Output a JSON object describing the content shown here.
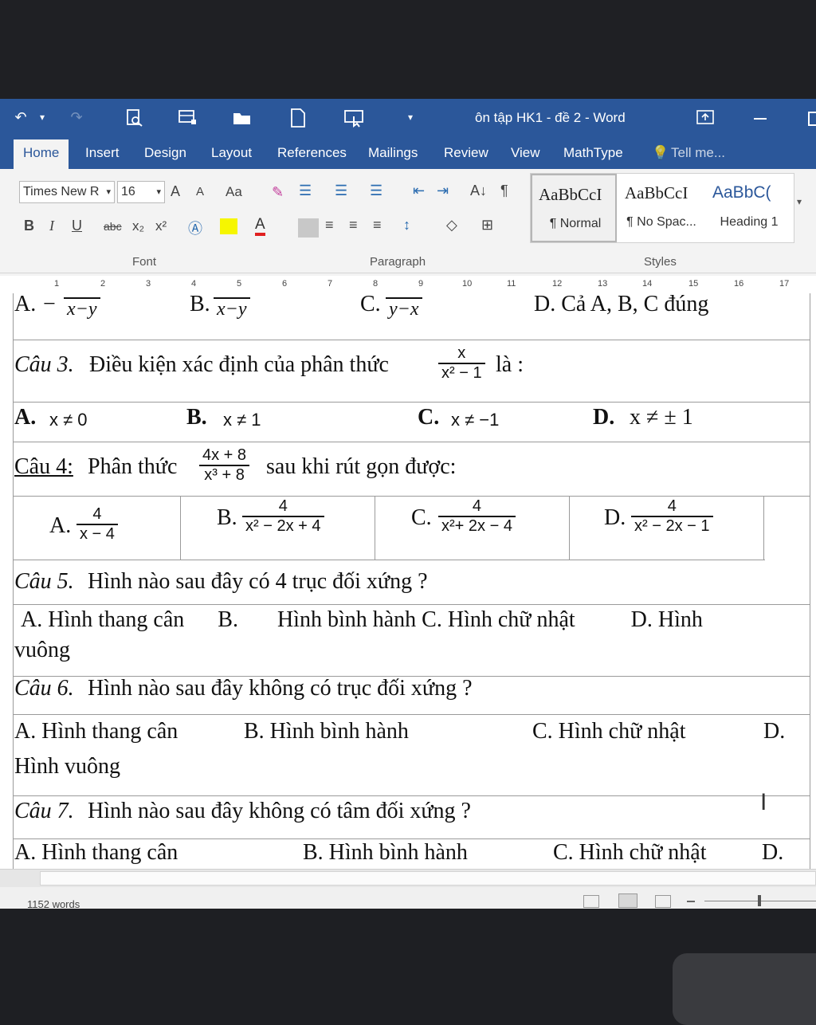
{
  "window": {
    "title": "ôn tập HK1 - đề 2 - Word"
  },
  "tabs": [
    "Home",
    "Insert",
    "Design",
    "Layout",
    "References",
    "Mailings",
    "Review",
    "View",
    "MathType"
  ],
  "tell_me": "Tell me...",
  "font": {
    "name": "Times New R",
    "size": "16"
  },
  "ribbon_glyphs": {
    "bold": "B",
    "italic": "I",
    "underline": "U",
    "strike": "abc",
    "sub": "x₂",
    "sup": "x²",
    "grow": "A",
    "shrink": "A",
    "case": "Aa",
    "pilcrow": "¶",
    "sort": "A↓"
  },
  "styles": [
    {
      "preview": "AaBbCcI",
      "name": "¶ Normal"
    },
    {
      "preview": "AaBbCcI",
      "name": "¶ No Spac..."
    },
    {
      "preview": "AaBbC(",
      "name": "Heading 1"
    }
  ],
  "group_labels": {
    "font": "Font",
    "paragraph": "Paragraph",
    "styles": "Styles"
  },
  "ruler": [
    "1",
    "2",
    "3",
    "4",
    "5",
    "6",
    "7",
    "8",
    "9",
    "10",
    "11",
    "12",
    "13",
    "14",
    "15",
    "16",
    "17"
  ],
  "document": {
    "q2_opts": {
      "a": {
        "label": "A.",
        "num": "",
        "den": "x−y",
        "sign": "−"
      },
      "b": {
        "label": "B.",
        "num": "",
        "den": "x−y"
      },
      "c": {
        "label": "C.",
        "num": "",
        "den": "y−x"
      },
      "d": {
        "label": "D. Cả A, B, C đúng"
      }
    },
    "q3": {
      "label": "Câu 3.",
      "text": "Điều kiện xác định của phân thức",
      "num": "x",
      "den": "x² − 1",
      "tail": "là :",
      "a_label": "A.",
      "a": "x ≠ 0",
      "b_label": "B.",
      "b": "x ≠ 1",
      "c_label": "C.",
      "c": "x ≠ −1",
      "d_label": "D.",
      "d": "x ≠ ± 1"
    },
    "q4": {
      "label": "Câu 4:",
      "text": "Phân thức",
      "num": "4x + 8",
      "den": "x³ + 8",
      "tail": "sau khi rút gọn được:",
      "a_label": "A.",
      "a_num": "4",
      "a_den": "x − 4",
      "b_label": "B.",
      "b_num": "4",
      "b_den": "x² − 2x + 4",
      "c_label": "C.",
      "c_num": "4",
      "c_den": "x²+ 2x − 4",
      "d_label": "D.",
      "d_num": "4",
      "d_den": "x² − 2x − 1"
    },
    "q5": {
      "label": "Câu 5.",
      "text": "Hình nào sau đây có 4 trục đối xứng ?",
      "line1": "A. Hình thang cân      B.       Hình bình hành C. Hình chữ nhật          D. Hình",
      "line2": "vuông"
    },
    "q6": {
      "label": "Câu 6.",
      "text": "Hình nào sau đây không có trục đối xứng ?",
      "a": "A. Hình thang cân",
      "b": "B. Hình bình hành",
      "c": "C. Hình chữ nhật",
      "d": "D.",
      "line2": "Hình vuông"
    },
    "q7": {
      "label": "Câu 7.",
      "text": "Hình nào sau đây không có tâm đối xứng ?",
      "a": "A. Hình thang cân",
      "b": "B. Hình bình hành",
      "c": "C. Hình chữ nhật",
      "d": "D."
    }
  },
  "status": {
    "words": "1152 words"
  }
}
